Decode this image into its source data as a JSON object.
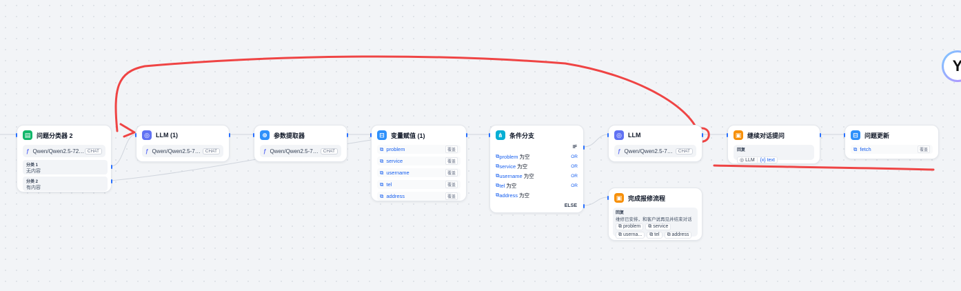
{
  "nodes": {
    "classifier": {
      "title": "问题分类器 2",
      "model": "Qwen/Qwen2.5-72B...",
      "model_tag": "CHAT",
      "classes": [
        {
          "label": "分类 1",
          "value": "无内容"
        },
        {
          "label": "分类 2",
          "value": "有内容"
        }
      ]
    },
    "llm1": {
      "title": "LLM (1)",
      "model": "Qwen/Qwen2.5-72B...",
      "model_tag": "CHAT"
    },
    "extractor": {
      "title": "参数提取器",
      "model": "Qwen/Qwen2.5-72B...",
      "model_tag": "CHAT"
    },
    "assign": {
      "title": "变量赋值 (1)",
      "tag": "覆盖",
      "vars": [
        "problem",
        "service",
        "username",
        "tel",
        "address"
      ]
    },
    "ifelse": {
      "title": "条件分支",
      "if_label": "IF",
      "else_label": "ELSE",
      "or_label": "OR",
      "op": "为空",
      "conds": [
        "problem",
        "service",
        "username",
        "tel",
        "address"
      ]
    },
    "llm2": {
      "title": "LLM",
      "model": "Qwen/Qwen2.5-72B...",
      "model_tag": "CHAT"
    },
    "continue": {
      "title": "继续对话提问",
      "body_label": "回复",
      "ref_node": "LLM",
      "ref_var": "{x} text"
    },
    "update": {
      "title": "问题更新",
      "var": "fetch",
      "tag": "覆盖"
    },
    "finish": {
      "title": "完成报修流程",
      "body_label": "回复",
      "text": "维修已安排，和客户说再见并结束对话",
      "vars": [
        "problem",
        "service",
        "userna...",
        "tel",
        "address"
      ]
    }
  },
  "colors": {
    "accent": "#2970ff",
    "annotation": "#f04438",
    "classifier_icon": "#12b76a",
    "llm_icon": "#6172f3",
    "extractor_icon": "#2e90fa",
    "assign_icon": "#2e90fa",
    "ifelse_icon": "#06aed4",
    "answer_icon": "#f79009"
  }
}
